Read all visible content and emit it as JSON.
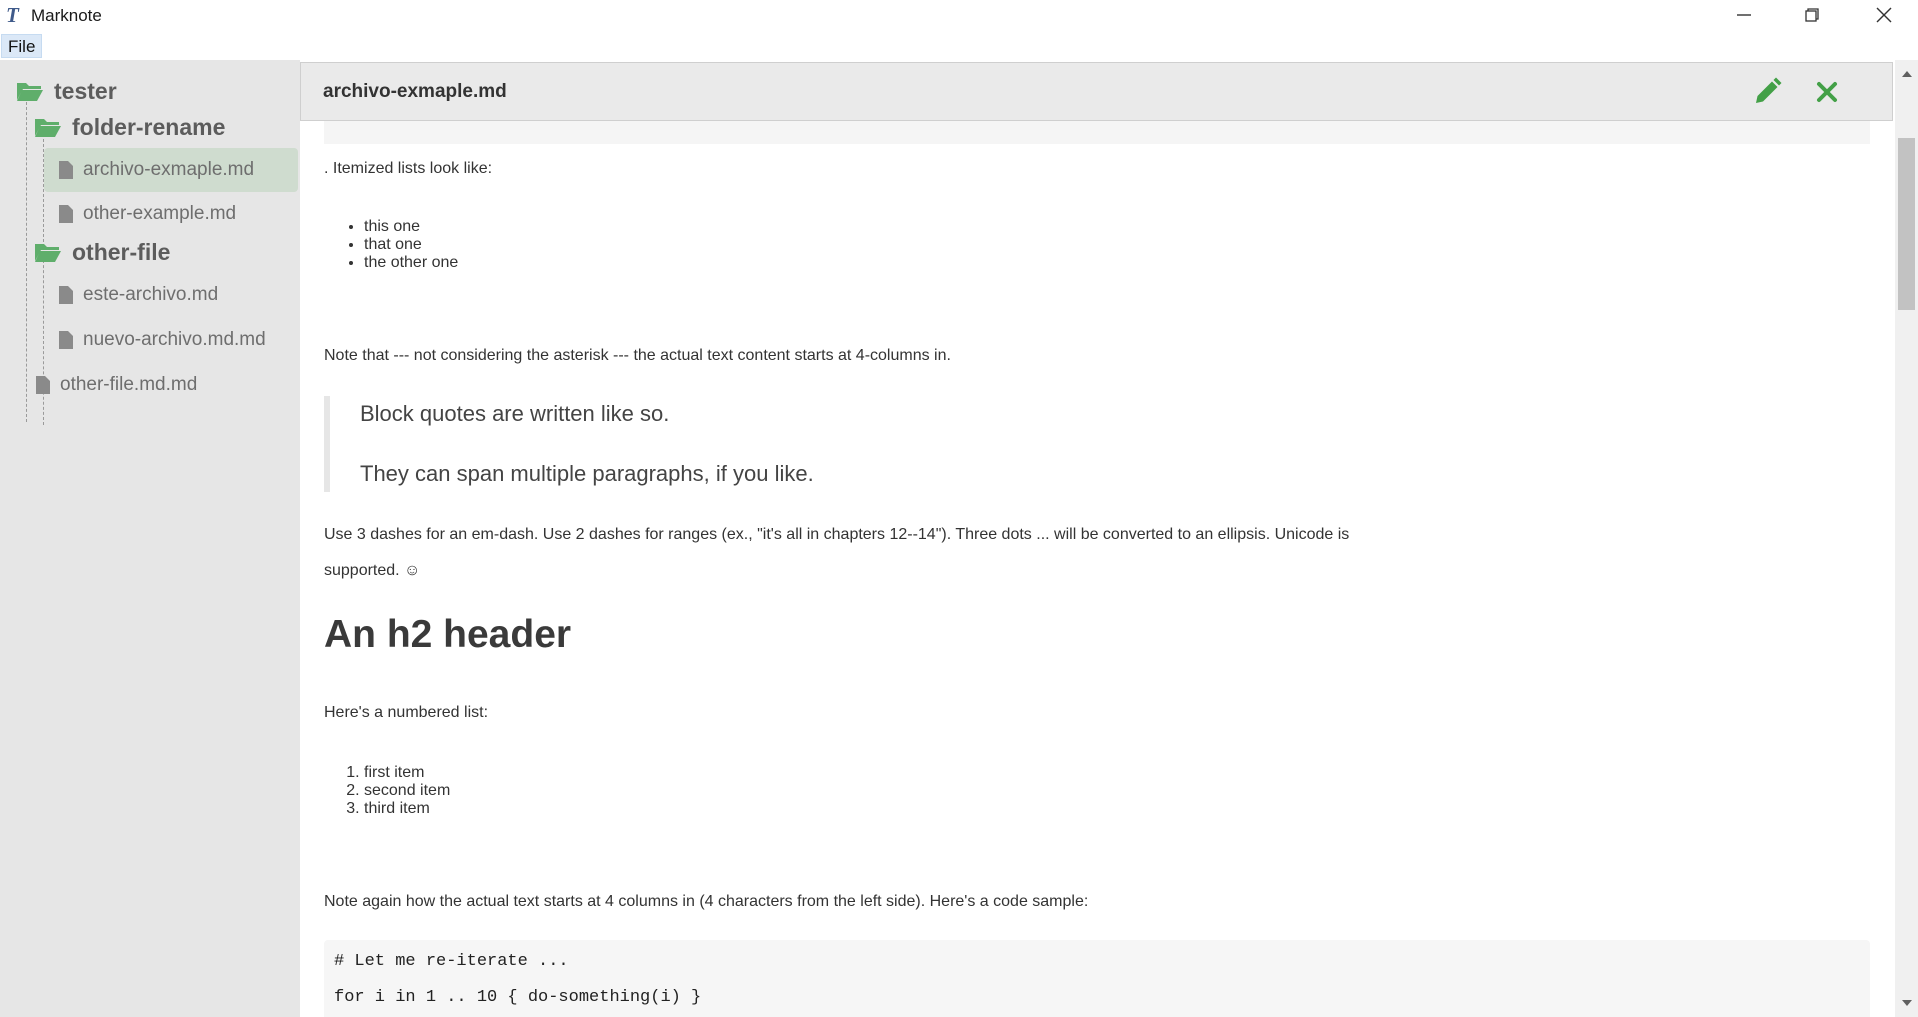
{
  "window": {
    "title": "Marknote",
    "app_icon": "T",
    "controls": [
      "minimize-icon",
      "maximize-icon",
      "close-icon"
    ]
  },
  "menu": {
    "file": "File"
  },
  "colors": {
    "folder_green": "#5fae6b",
    "accent_green": "#43a047",
    "selected_bg": "#cfdccf",
    "sidebar_bg": "#e6e6e6"
  },
  "sidebar": {
    "root": "tester",
    "folder1": "folder-rename",
    "folder1_files": [
      "archivo-exmaple.md",
      "other-example.md"
    ],
    "folder2": "other-file",
    "folder2_files": [
      "este-archivo.md",
      "nuevo-archivo.md.md"
    ],
    "root_file": "other-file.md.md"
  },
  "document": {
    "tab_title": "archivo-exmaple.md",
    "p_itemized": ". Itemized lists look like:",
    "bullets": [
      "this one",
      "that one",
      "the other one"
    ],
    "p_note1": "Note that --- not considering the asterisk --- the actual text content starts at 4-columns in.",
    "quote1": "Block quotes are written like so.",
    "quote2": "They can span multiple paragraphs, if you like.",
    "p_dashes_1": "Use 3 dashes for an em-dash. Use 2 dashes for ranges (ex., \"it's all in chapters 12--14\"). Three dots ... will be converted to an ellipsis. Unicode is",
    "p_dashes_2": "supported. ☺",
    "h2": "An h2 header",
    "p_numbered": "Here's a numbered list:",
    "numbered": [
      "first item",
      "second item",
      "third item"
    ],
    "p_note2": "Note again how the actual text starts at 4 columns in (4 characters from the left side). Here's a code sample:",
    "code_lines": [
      "# Let me re-iterate ...",
      "for i in 1 .. 10 { do-something(i) }"
    ]
  }
}
